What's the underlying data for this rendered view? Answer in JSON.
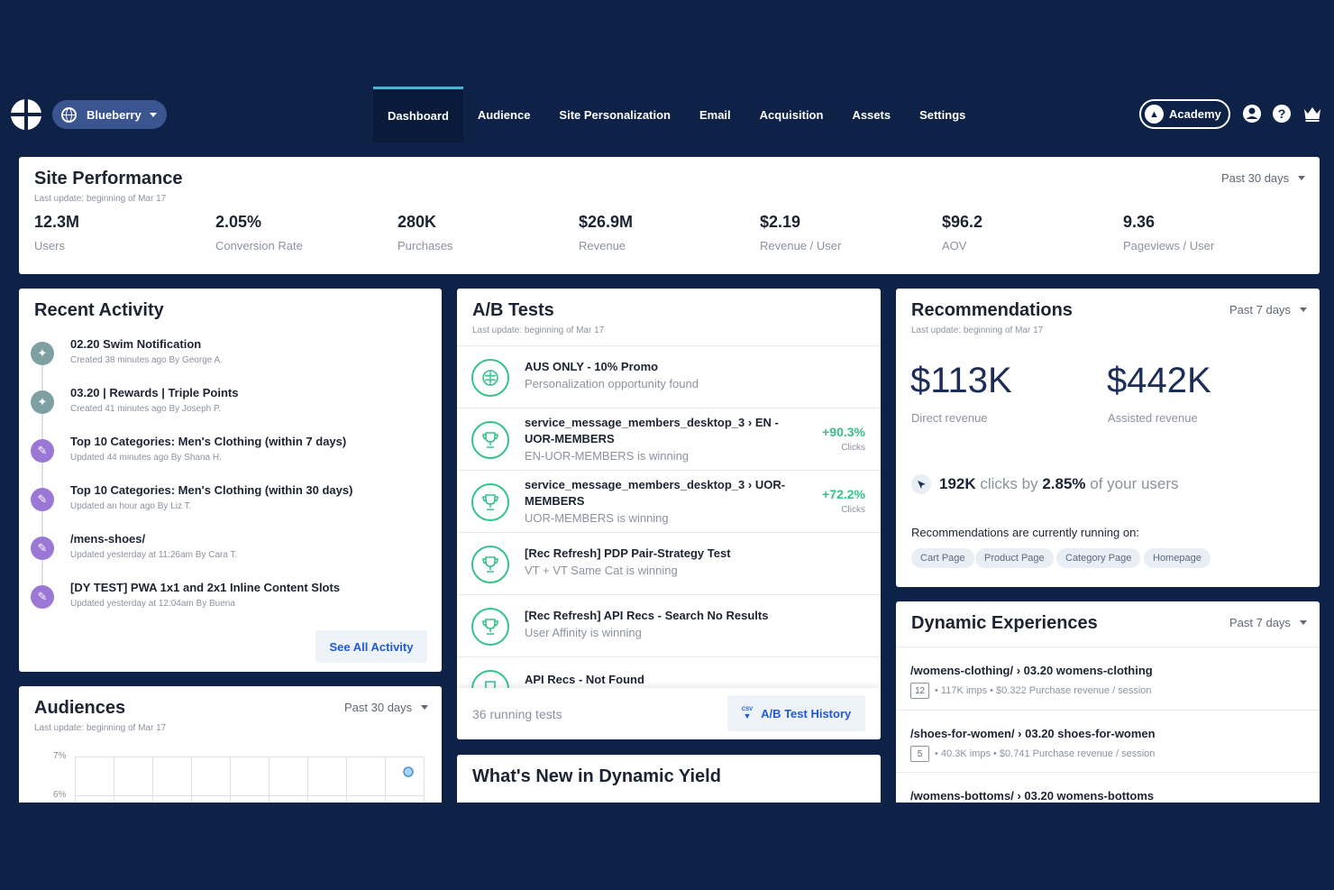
{
  "nav": {
    "site_name": "Blueberry",
    "tabs": [
      "Dashboard",
      "Audience",
      "Site Personalization",
      "Email",
      "Acquisition",
      "Assets",
      "Settings"
    ],
    "academy_label": "Academy"
  },
  "site_performance": {
    "title": "Site Performance",
    "last_update": "Last update: beginning of Mar 17",
    "period": "Past 30 days",
    "metrics": [
      {
        "value": "12.3M",
        "label": "Users"
      },
      {
        "value": "2.05%",
        "label": "Conversion Rate"
      },
      {
        "value": "280K",
        "label": "Purchases"
      },
      {
        "value": "$26.9M",
        "label": "Revenue"
      },
      {
        "value": "$2.19",
        "label": "Revenue / User"
      },
      {
        "value": "$96.2",
        "label": "AOV"
      },
      {
        "value": "9.36",
        "label": "Pageviews / User"
      }
    ]
  },
  "recent_activity": {
    "title": "Recent Activity",
    "items": [
      {
        "title": "02.20 Swim Notification",
        "meta": "Created 38 minutes ago By George A.",
        "kind": "created"
      },
      {
        "title": "03.20 | Rewards | Triple Points",
        "meta": "Created 41 minutes ago By Joseph P.",
        "kind": "created"
      },
      {
        "title": "Top 10 Categories: Men's Clothing (within 7 days)",
        "meta": "Updated 44 minutes ago By Shana H.",
        "kind": "updated"
      },
      {
        "title": "Top 10 Categories: Men's Clothing (within 30 days)",
        "meta": "Updated an hour ago By Liz T.",
        "kind": "updated"
      },
      {
        "title": "/mens-shoes/",
        "meta": "Updated yesterday at 11:26am By Cara T.",
        "kind": "updated"
      },
      {
        "title": "[DY TEST] PWA 1x1 and 2x1 Inline Content Slots",
        "meta": "Updated yesterday at 12:04am By Buena",
        "kind": "updated"
      }
    ],
    "see_all": "See All Activity"
  },
  "ab_tests": {
    "title": "A/B Tests",
    "last_update": "Last update: beginning of Mar 17",
    "rows": [
      {
        "title": "AUS ONLY - 10% Promo",
        "sub": "Personalization opportunity found",
        "lift": "",
        "clicks": ""
      },
      {
        "title": "service_message_members_desktop_3 › EN - UOR-MEMBERS",
        "sub": "EN-UOR-MEMBERS is winning",
        "lift": "+90.3%",
        "clicks": "Clicks"
      },
      {
        "title": "service_message_members_desktop_3 › UOR-MEMBERS",
        "sub": "UOR-MEMBERS is winning",
        "lift": "+72.2%",
        "clicks": "Clicks"
      },
      {
        "title": "[Rec Refresh] PDP Pair-Strategy Test",
        "sub": "VT + VT Same Cat is winning",
        "lift": "",
        "clicks": ""
      },
      {
        "title": "[Rec Refresh] API Recs - Search No Results",
        "sub": "User Affinity is winning",
        "lift": "",
        "clicks": ""
      },
      {
        "title": "API Recs - Not Found",
        "sub": "",
        "lift": "",
        "clicks": ""
      }
    ],
    "running": "36 running tests",
    "history_button": "A/B Test History",
    "csv_label": "CSV"
  },
  "whats_new": {
    "title": "What's New in Dynamic Yield"
  },
  "recommendations": {
    "title": "Recommendations",
    "last_update": "Last update: beginning of Mar 17",
    "period": "Past 7 days",
    "direct_value": "$113K",
    "direct_label": "Direct revenue",
    "assisted_value": "$442K",
    "assisted_label": "Assisted revenue",
    "clicks_value": "192K",
    "clicks_mid": "clicks by",
    "users_pct": "2.85%",
    "clicks_tail": "of your users",
    "running_on": "Recommendations are currently running on:",
    "pages": [
      "Cart Page",
      "Product Page",
      "Category Page",
      "Homepage"
    ]
  },
  "audiences": {
    "title": "Audiences",
    "last_update": "Last update: beginning of Mar 17",
    "period": "Past 30 days",
    "y_ticks": [
      "7%",
      "6%"
    ]
  },
  "dynamic_experiences": {
    "title": "Dynamic Experiences",
    "period": "Past 7 days",
    "rows": [
      {
        "title": "/womens-clothing/ › 03.20 womens-clothing",
        "badge": "12",
        "imps": "117K imps",
        "revenue": "$0.322",
        "revenue_label": "Purchase revenue / session"
      },
      {
        "title": "/shoes-for-women/ › 03.20 shoes-for-women",
        "badge": "5",
        "imps": "40.3K imps",
        "revenue": "$0.741",
        "revenue_label": "Purchase revenue / session"
      },
      {
        "title": "/womens-bottoms/ › 03.20 womens-bottoms",
        "badge": "",
        "imps": "",
        "revenue": "",
        "revenue_label": ""
      }
    ]
  },
  "colors": {
    "navy": "#0e2147",
    "accent_green": "#36c28a",
    "link_blue": "#1f5ad6",
    "activity_created": "#7fa0a3",
    "activity_updated": "#9b78d6"
  }
}
